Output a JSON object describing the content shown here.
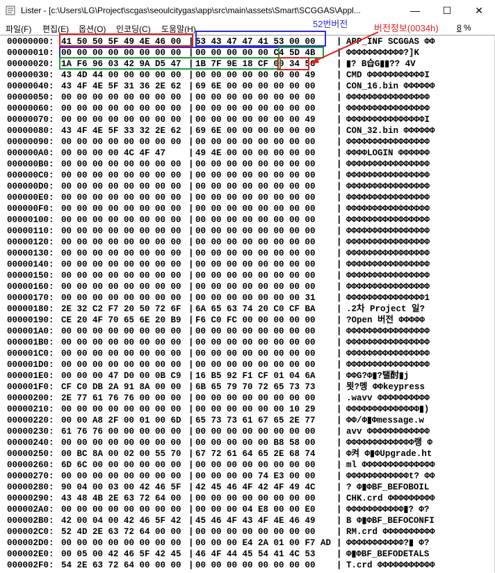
{
  "window": {
    "title": "Lister - [c:\\Users\\LG\\Project\\scgas\\seoulcitygas\\app\\src\\main\\assets\\Smart\\SCGGAS\\Appl...",
    "minimize_label": "—",
    "maximize_label": "☐",
    "close_label": "✕"
  },
  "menu": {
    "items": [
      {
        "label": "파일(F)"
      },
      {
        "label": "편집(E)"
      },
      {
        "label": "옵션(O)"
      },
      {
        "label": "인코딩(C)"
      },
      {
        "label": "도움말(H)"
      }
    ],
    "percent": "8",
    "percent_suffix": " %"
  },
  "annotations": {
    "version_info": "버전정보(0034h)",
    "version_52": "52번버전",
    "red": "#e0201f",
    "blue": "#2f2fc8",
    "green": "#1a9e3a"
  },
  "rows": [
    {
      "addr": "00000000:",
      "hexA": "41 50 50 5F 49 4E 46 00",
      "hexB": "53 43 47 47 41 53 00 00",
      "ascii": "APP_INF SCGGAS ΦΦ"
    },
    {
      "addr": "00000010:",
      "hexA": "00 00 00 00 00 00 00 00",
      "hexB": "00 00 00 00 00 C4 5D 4B",
      "ascii": "ΦΦΦΦΦΦΦΦΦΦΦ?]K"
    },
    {
      "addr": "00000020:",
      "hexA": "1A F6 96 03 42 9A D5 47",
      "hexB": "1B 7F 9E 18 CF 00 34 56",
      "ascii": "▮? B습G▮▮?? 4V"
    },
    {
      "addr": "00000030:",
      "hexA": "43 4D 44 00 00 00 00 00",
      "hexB": "00 00 00 00 00 00 00 49",
      "ascii": "CMD ΦΦΦΦΦΦΦΦΦΦΦI"
    },
    {
      "addr": "00000040:",
      "hexA": "43 4F 4E 5F 31 36 2E 62",
      "hexB": "69 6E 00 00 00 00 00 00",
      "ascii": "CON_16.bin ΦΦΦΦΦΦ"
    },
    {
      "addr": "00000050:",
      "hexA": "00 00 00 00 00 00 00 00",
      "hexB": "00 00 00 00 00 00 00 00",
      "ascii": "ΦΦΦΦΦΦΦΦΦΦΦΦΦΦΦΦ"
    },
    {
      "addr": "00000060:",
      "hexA": "00 00 00 00 00 00 00 00",
      "hexB": "00 00 00 00 00 00 00 00",
      "ascii": "ΦΦΦΦΦΦΦΦΦΦΦΦΦΦΦΦ"
    },
    {
      "addr": "00000070:",
      "hexA": "00 00 00 00 00 00 00 00",
      "hexB": "00 00 00 00 00 00 00 49",
      "ascii": "ΦΦΦΦΦΦΦΦΦΦΦΦΦΦΦI"
    },
    {
      "addr": "00000080:",
      "hexA": "43 4F 4E 5F 33 32 2E 62",
      "hexB": "69 6E 00 00 00 00 00 00",
      "ascii": "CON_32.bin ΦΦΦΦΦΦ"
    },
    {
      "addr": "00000090:",
      "hexA": "00 00 00 00 00 00 00 00",
      "hexB": "00 00 00 00 00 00 00 00",
      "ascii": "ΦΦΦΦΦΦΦΦΦΦΦΦΦΦΦΦ"
    },
    {
      "addr": "000000A0:",
      "hexA": "00 00 00 00 4C 4F 47",
      "hexB": "49 4E 00 00 00 00 00 00",
      "ascii": "ΦΦΦΦLOGIN ΦΦΦΦΦΦ"
    },
    {
      "addr": "000000B0:",
      "hexA": "00 00 00 00 00 00 00 00",
      "hexB": "00 00 00 00 00 00 00 00",
      "ascii": "ΦΦΦΦΦΦΦΦΦΦΦΦΦΦΦΦ"
    },
    {
      "addr": "000000C0:",
      "hexA": "00 00 00 00 00 00 00 00",
      "hexB": "00 00 00 00 00 00 00 00",
      "ascii": "ΦΦΦΦΦΦΦΦΦΦΦΦΦΦΦΦ"
    },
    {
      "addr": "000000D0:",
      "hexA": "00 00 00 00 00 00 00 00",
      "hexB": "00 00 00 00 00 00 00 00",
      "ascii": "ΦΦΦΦΦΦΦΦΦΦΦΦΦΦΦΦ"
    },
    {
      "addr": "000000E0:",
      "hexA": "00 00 00 00 00 00 00 00",
      "hexB": "00 00 00 00 00 00 00 00",
      "ascii": "ΦΦΦΦΦΦΦΦΦΦΦΦΦΦΦΦ"
    },
    {
      "addr": "000000F0:",
      "hexA": "00 00 00 00 00 00 00 00",
      "hexB": "00 00 00 00 00 00 00 00",
      "ascii": "ΦΦΦΦΦΦΦΦΦΦΦΦΦΦΦΦ"
    },
    {
      "addr": "00000100:",
      "hexA": "00 00 00 00 00 00 00 00",
      "hexB": "00 00 00 00 00 00 00 00",
      "ascii": "ΦΦΦΦΦΦΦΦΦΦΦΦΦΦΦΦ"
    },
    {
      "addr": "00000110:",
      "hexA": "00 00 00 00 00 00 00 00",
      "hexB": "00 00 00 00 00 00 00 00",
      "ascii": "ΦΦΦΦΦΦΦΦΦΦΦΦΦΦΦΦ"
    },
    {
      "addr": "00000120:",
      "hexA": "00 00 00 00 00 00 00 00",
      "hexB": "00 00 00 00 00 00 00 00",
      "ascii": "ΦΦΦΦΦΦΦΦΦΦΦΦΦΦΦΦ"
    },
    {
      "addr": "00000130:",
      "hexA": "00 00 00 00 00 00 00 00",
      "hexB": "00 00 00 00 00 00 00 00",
      "ascii": "ΦΦΦΦΦΦΦΦΦΦΦΦΦΦΦΦ"
    },
    {
      "addr": "00000140:",
      "hexA": "00 00 00 00 00 00 00 00",
      "hexB": "00 00 00 00 00 00 00 00",
      "ascii": "ΦΦΦΦΦΦΦΦΦΦΦΦΦΦΦΦ"
    },
    {
      "addr": "00000150:",
      "hexA": "00 00 00 00 00 00 00 00",
      "hexB": "00 00 00 00 00 00 00 00",
      "ascii": "ΦΦΦΦΦΦΦΦΦΦΦΦΦΦΦΦ"
    },
    {
      "addr": "00000160:",
      "hexA": "00 00 00 00 00 00 00 00",
      "hexB": "00 00 00 00 00 00 00 00",
      "ascii": "ΦΦΦΦΦΦΦΦΦΦΦΦΦΦΦΦ"
    },
    {
      "addr": "00000170:",
      "hexA": "00 00 00 00 00 00 00 00",
      "hexB": "00 00 00 00 00 00 00 31",
      "ascii": "ΦΦΦΦΦΦΦΦΦΦΦΦΦΦΦ1"
    },
    {
      "addr": "00000180:",
      "hexA": "2E 32 C2 F7 20 50 72 6F",
      "hexB": "6A 65 63 74 20 C0 CF BA",
      "ascii": ".2차 Project 일?"
    },
    {
      "addr": "00000190:",
      "hexA": "CE 20 4F 70 65 6E 20 B9",
      "hexB": "F6 C0 FC 00 00 00 00 00",
      "ascii": "?Open 버전 ΦΦΦΦΦ"
    },
    {
      "addr": "000001A0:",
      "hexA": "00 00 00 00 00 00 00 00",
      "hexB": "00 00 00 00 00 00 00 00",
      "ascii": "ΦΦΦΦΦΦΦΦΦΦΦΦΦΦΦΦ"
    },
    {
      "addr": "000001B0:",
      "hexA": "00 00 00 00 00 00 00 00",
      "hexB": "00 00 00 00 00 00 00 00",
      "ascii": "ΦΦΦΦΦΦΦΦΦΦΦΦΦΦΦΦ"
    },
    {
      "addr": "000001C0:",
      "hexA": "00 00 00 00 00 00 00 00",
      "hexB": "00 00 00 00 00 00 00 00",
      "ascii": "ΦΦΦΦΦΦΦΦΦΦΦΦΦΦΦΦ"
    },
    {
      "addr": "000001D0:",
      "hexA": "00 00 00 00 00 00 00 00",
      "hexB": "00 00 00 00 00 00 00 00",
      "ascii": "ΦΦΦΦΦΦΦΦΦΦΦΦΦΦΦΦ"
    },
    {
      "addr": "000001E0:",
      "hexA": "00 00 00 47 D0 00 0B C9",
      "hexB": "16 B5 92 F1 CF 01 04 6A",
      "ascii": "ΦΦG?Φ▮?탤酎▮j"
    },
    {
      "addr": "000001F0:",
      "hexA": "CF C0 DB 2A 91 8A 00 00",
      "hexB": "6B 65 79 70 72 65 73 73",
      "ascii": "묏?멩 ΦΦkeypress"
    },
    {
      "addr": "00000200:",
      "hexA": "2E 77 61 76 76 00 00 00",
      "hexB": "00 00 00 00 00 00 00 00",
      "ascii": ".wavv ΦΦΦΦΦΦΦΦΦΦ"
    },
    {
      "addr": "00000210:",
      "hexA": "00 00 00 00 00 00 00 00",
      "hexB": "00 00 00 00 00 00 10 29",
      "ascii": "ΦΦΦΦΦΦΦΦΦΦΦΦΦΦ▮)"
    },
    {
      "addr": "00000220:",
      "hexA": "00 00 A8 2F 00 01 00 6D",
      "hexB": "65 73 73 61 67 65 2E 77",
      "ascii": "ΦΦ/Φ▮Φmessage.w"
    },
    {
      "addr": "00000230:",
      "hexA": "61 76 76 00 00 00 00 00",
      "hexB": "00 00 00 00 00 00 00 00",
      "ascii": "avv ΦΦΦΦΦΦΦΦΦΦΦΦ"
    },
    {
      "addr": "00000240:",
      "hexA": "00 00 00 00 00 00 00 00",
      "hexB": "00 00 00 00 00 B8 58 00",
      "ascii": "ΦΦΦΦΦΦΦΦΦΦΦΦΦ랭 Φ"
    },
    {
      "addr": "00000250:",
      "hexA": "00 BC 8A 00 02 00 55 70",
      "hexB": "67 72 61 64 65 2E 68 74",
      "ascii": "Φ켜 Φ▮ΦUpgrade.ht"
    },
    {
      "addr": "00000260:",
      "hexA": "6D 6C 00 00 00 00 00 00",
      "hexB": "00 00 00 00 00 00 00 00",
      "ascii": "ml ΦΦΦΦΦΦΦΦΦΦΦΦΦΦ"
    },
    {
      "addr": "00000270:",
      "hexA": "00 00 00 00 00 00 00 00",
      "hexB": "00 00 00 00 74 E3 00 00",
      "ascii": "ΦΦΦΦΦΦΦΦΦΦΦΦt? ΦΦ"
    },
    {
      "addr": "00000280:",
      "hexA": "90 04 00 03 00 42 46 5F",
      "hexB": "42 45 46 4F 42 4F 49 4C",
      "ascii": "? Φ▮ΦBF_BEFOBOIL"
    },
    {
      "addr": "00000290:",
      "hexA": "43 48 4B 2E 63 72 64 00",
      "hexB": "00 00 00 00 00 00 00 00",
      "ascii": "CHK.crd ΦΦΦΦΦΦΦΦΦ"
    },
    {
      "addr": "000002A0:",
      "hexA": "00 00 00 00 00 00 00 00",
      "hexB": "00 00 00 04 E8 00 00 E0",
      "ascii": "ΦΦΦΦΦΦΦΦΦΦΦ▮? Φ?"
    },
    {
      "addr": "000002B0:",
      "hexA": "42 00 04 00 42 46 5F 42",
      "hexB": "45 46 4F 43 4F 4E 46 49",
      "ascii": "B Φ▮ΦBF_BEFOCONFI"
    },
    {
      "addr": "000002C0:",
      "hexA": "52 4D 2E 63 72 64 00 00",
      "hexB": "00 00 00 00 00 00 00 00",
      "ascii": "RM.crd ΦΦΦΦΦΦΦΦΦΦ"
    },
    {
      "addr": "000002D0:",
      "hexA": "00 00 00 00 00 00 00 00",
      "hexB": "00 00 00 E4 2A 01 00 F7 AD",
      "ascii": "ΦΦΦΦΦΦΦΦΦΦΦ?▮ Φ?"
    },
    {
      "addr": "000002E0:",
      "hexA": "00 05 00 42 46 5F 42 45",
      "hexB": "46 4F 44 45 54 41 4C 53",
      "ascii": "Φ▮ΦBF_BEFODETALS"
    },
    {
      "addr": "000002F0:",
      "hexA": "54 2E 63 72 64 00 00 00",
      "hexB": "00 00 00 00 00 00 00 00",
      "ascii": "T.crd ΦΦΦΦΦΦΦΦΦΦΦ"
    }
  ]
}
